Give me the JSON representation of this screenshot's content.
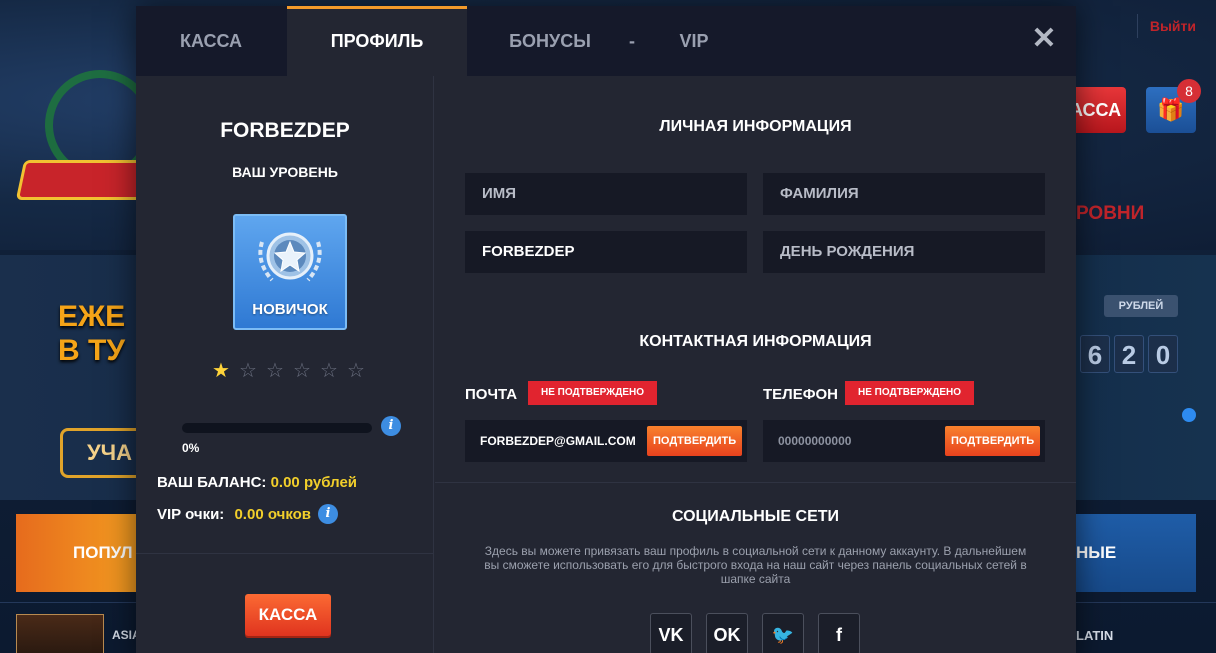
{
  "background": {
    "exit_link": "Выйти",
    "kassa_button": "АССА",
    "gift_badge": "8",
    "levels_text": "РОВНИ",
    "banner_text": "ЕЖЕ\nВ ТУ",
    "participate_button": "УЧА",
    "rubles_label": "РУБЛЕЙ",
    "jackpot_digits": [
      "6",
      "2",
      "0"
    ],
    "popular_tab": "ПОПУЛ",
    "new_tab": "НЫЕ",
    "game_left": "ASIA",
    "game_right": "LATIN"
  },
  "modal": {
    "tabs": [
      {
        "label": "КАССА",
        "active": false
      },
      {
        "label": "ПРОФИЛЬ",
        "active": true
      },
      {
        "label": "БОНУСЫ",
        "active": false
      },
      {
        "label": "-",
        "active": false
      },
      {
        "label": "VIP",
        "active": false
      }
    ],
    "close_icon": "close-icon",
    "left": {
      "username": "FORBEZDEP",
      "level_title": "ВАШ УРОВЕНЬ",
      "level_name": "НОВИЧОК",
      "stars_total": 6,
      "stars_filled": 1,
      "progress_value": 0,
      "progress_label": "0%",
      "balance_label": "ВАШ БАЛАНС:",
      "balance_value": "0.00 рублей",
      "vip_label": "VIP очки:",
      "vip_value": "0.00 очков",
      "kassa_button": "КАССА"
    },
    "right": {
      "personal_title": "ЛИЧНАЯ ИНФОРМАЦИЯ",
      "first_name_placeholder": "ИМЯ",
      "last_name_placeholder": "ФАМИЛИЯ",
      "login_value": "FORBEZDEP",
      "birthday_placeholder": "ДЕНЬ РОЖДЕНИЯ",
      "contact_title": "КОНТАКТНАЯ ИНФОРМАЦИЯ",
      "email_label": "ПОЧТА",
      "email_status": "НЕ ПОДТВЕРЖДЕНО",
      "email_value": "FORBEZDEP@GMAIL.COM",
      "email_confirm": "ПОДТВЕРДИТЬ",
      "phone_label": "ТЕЛЕФОН",
      "phone_status": "НЕ ПОДТВЕРЖДЕНО",
      "phone_value": "00000000000",
      "phone_confirm": "ПОДТВЕРДИТЬ",
      "social_title": "СОЦИАЛЬНЫЕ СЕТИ",
      "social_text": "Здесь вы можете привязать ваш профиль в социальной сети к данному аккаунту. В дальнейшем вы сможете использовать его для быстрого входа на наш сайт через панель социальных сетей в шапке сайта",
      "social_buttons": [
        {
          "icon": "vk-icon",
          "glyph": "VK"
        },
        {
          "icon": "odnoklassniki-icon",
          "glyph": "OK"
        },
        {
          "icon": "twitter-icon",
          "glyph": "🐦"
        },
        {
          "icon": "facebook-icon",
          "glyph": "f"
        }
      ]
    }
  },
  "colors": {
    "accent_orange": "#f29a2b",
    "status_red": "#e1242f",
    "value_yellow": "#f2cf2b",
    "badge_blue": "#3d8de2"
  }
}
